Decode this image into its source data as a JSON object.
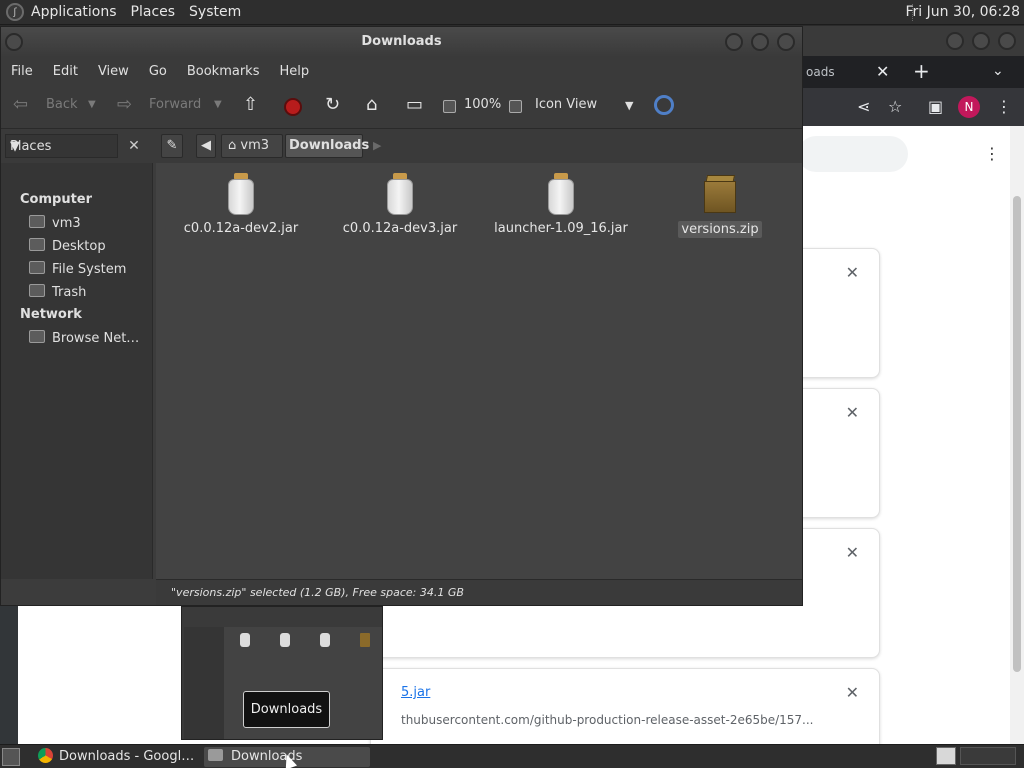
{
  "top_panel": {
    "menus": [
      "Applications",
      "Places",
      "System"
    ],
    "clock": "Fri Jun 30, 06:28"
  },
  "chrome": {
    "tab_partial_label": "oads",
    "page": {
      "download_item": {
        "filename_partial": "5.jar",
        "url_partial": "thubusercontent.com/github-production-release-asset-2e65be/157..."
      }
    },
    "avatar_letter": "N"
  },
  "file_manager": {
    "title": "Downloads",
    "menu": [
      "File",
      "Edit",
      "View",
      "Go",
      "Bookmarks",
      "Help"
    ],
    "toolbar": {
      "back_label": "Back",
      "forward_label": "Forward",
      "zoom": "100%",
      "view_mode": "Icon View"
    },
    "pane_selector": "Places",
    "breadcrumbs": [
      "vm3",
      "Downloads"
    ],
    "sidebar": {
      "computer_heading": "Computer",
      "computer_items": [
        "vm3",
        "Desktop",
        "File System",
        "Trash"
      ],
      "network_heading": "Network",
      "network_items": [
        "Browse Net…"
      ]
    },
    "files": [
      {
        "name": "c0.0.12a-dev2.jar",
        "type": "jar"
      },
      {
        "name": "c0.0.12a-dev3.jar",
        "type": "jar"
      },
      {
        "name": "launcher-1.09_16.jar",
        "type": "jar"
      },
      {
        "name": "versions.zip",
        "type": "zip",
        "selected": true
      }
    ],
    "status": "\"versions.zip\" selected (1.2 GB), Free space: 34.1 GB"
  },
  "preview_tooltip": "Downloads",
  "taskbar": {
    "tasks": [
      {
        "label": "Downloads - Googl…",
        "icon": "chrome-icon"
      },
      {
        "label": "Downloads",
        "icon": "folder-icon",
        "active": true
      }
    ]
  }
}
